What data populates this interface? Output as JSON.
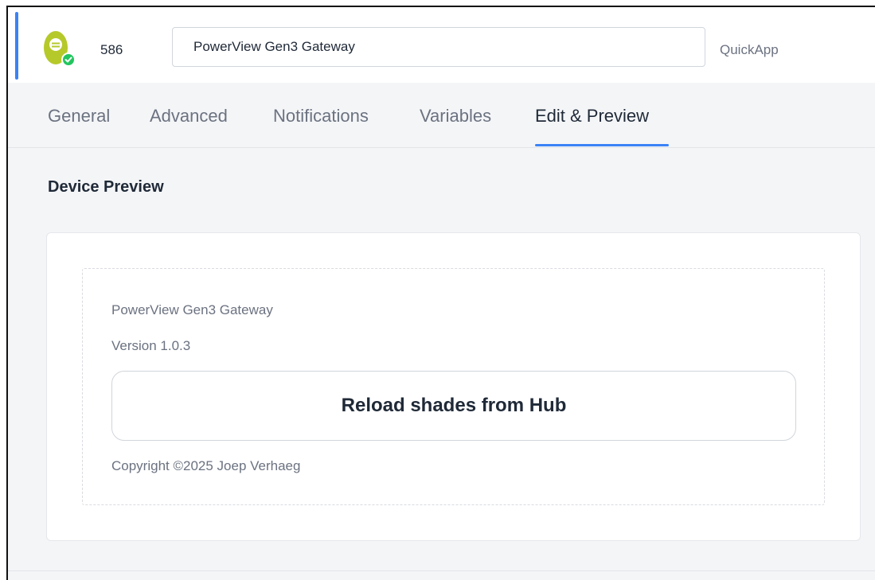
{
  "header": {
    "device_id": "586",
    "device_name": "PowerView Gen3 Gateway",
    "device_type": "QuickApp",
    "icon": "device-status-icon",
    "status": "online",
    "colors": {
      "icon_green": "#b6c92a",
      "status_green": "#22c55e"
    }
  },
  "tabs": [
    {
      "label": "General",
      "active": false
    },
    {
      "label": "Advanced",
      "active": false
    },
    {
      "label": "Notifications",
      "active": false
    },
    {
      "label": "Variables",
      "active": false
    },
    {
      "label": "Edit & Preview",
      "active": true
    }
  ],
  "accent_color": "#3b82f6",
  "preview": {
    "title": "Device Preview",
    "app_name": "PowerView Gen3 Gateway",
    "version": "Version 1.0.3",
    "button_label": "Reload shades from Hub",
    "copyright": "Copyright ©2025 Joep Verhaeg"
  }
}
